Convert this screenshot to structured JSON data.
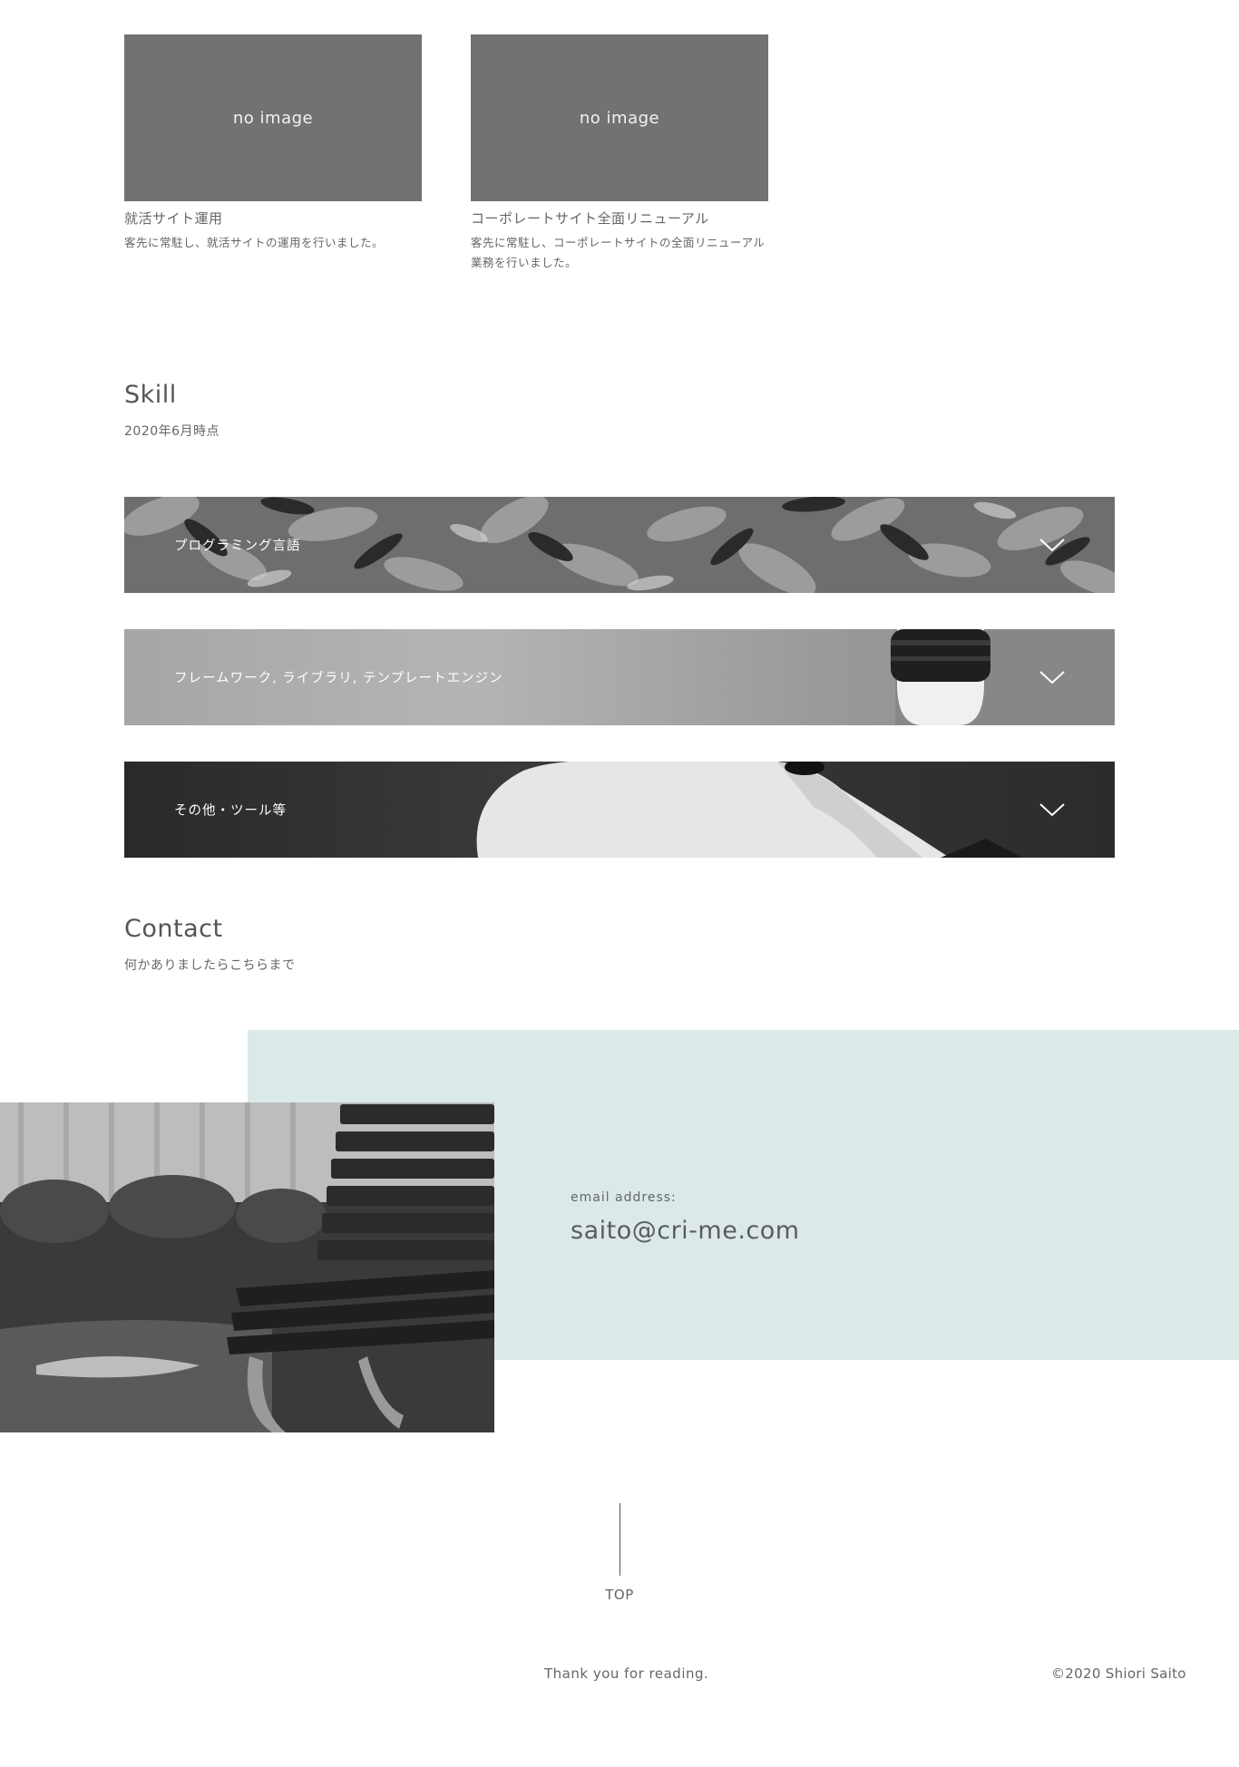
{
  "works": [
    {
      "thumb_text": "no image",
      "title": "就活サイト運用",
      "desc": "客先に常駐し、就活サイトの運用を行いました。"
    },
    {
      "thumb_text": "no image",
      "title": "コーポレートサイト全面リニューアル",
      "desc": "客先に常駐し、コーポレートサイトの全面リニューアル業務を行いました。"
    }
  ],
  "skill": {
    "title": "Skill",
    "subtitle": "2020年6月時点",
    "items": [
      {
        "label": "プログラミング言語",
        "icon": "chevron-down-icon"
      },
      {
        "label": "フレームワーク, ライブラリ, テンプレートエンジン",
        "icon": "chevron-down-icon"
      },
      {
        "label": "その他・ツール等",
        "icon": "chevron-down-icon"
      }
    ]
  },
  "contact": {
    "title": "Contact",
    "subtitle": "何かありましたらこちらまで",
    "email_label": "email address:",
    "email": "saito@cri-me.com"
  },
  "footer": {
    "top_label": "TOP",
    "thanks": "Thank you for reading.",
    "copyright": "©2020 Shiori Saito"
  },
  "colors": {
    "thumb_gray": "#727272",
    "contact_bg": "#dbe9e9",
    "text": "#555555"
  }
}
